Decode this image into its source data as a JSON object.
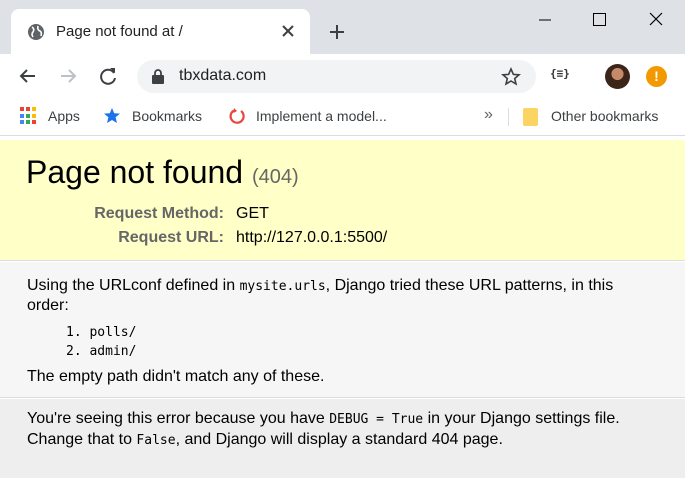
{
  "browser": {
    "tab": {
      "title": "Page not found at /"
    },
    "address_bar": {
      "url": "tbxdata.com"
    },
    "extension_label": "{≡}",
    "alert_symbol": "!",
    "bookmarks": [
      {
        "label": "Apps",
        "icon": "apps-grid-icon"
      },
      {
        "label": "Bookmarks",
        "icon": "star-icon"
      },
      {
        "label": "Implement a model...",
        "icon": "refresh-ring-icon"
      }
    ],
    "overflow_chevron": "»",
    "other_bookmarks": "Other bookmarks"
  },
  "page": {
    "heading": "Page not found",
    "status_code": "(404)",
    "request_method_label": "Request Method:",
    "request_method_value": "GET",
    "request_url_label": "Request URL:",
    "request_url_value": "http://127.0.0.1:5500/",
    "urlconf_prefix": "Using the URLconf defined in ",
    "urlconf_module": "mysite.urls",
    "urlconf_suffix": ", Django tried these URL patterns, in this order:",
    "patterns": [
      "1. polls/",
      "2. admin/"
    ],
    "no_match": "The empty path didn't match any of these.",
    "debug_prefix": "You're seeing this error because you have ",
    "debug_setting": "DEBUG = True",
    "debug_middle": " in your Django settings file. Change that to ",
    "debug_false": "False",
    "debug_suffix": ", and Django will display a standard 404 page."
  },
  "colors": {
    "summary_bg": "#ffffc8",
    "info_bg": "#f6f6f6",
    "explanation_bg": "#eeeeee",
    "tabstrip_bg": "#dee1e6",
    "alert": "#f29900"
  }
}
